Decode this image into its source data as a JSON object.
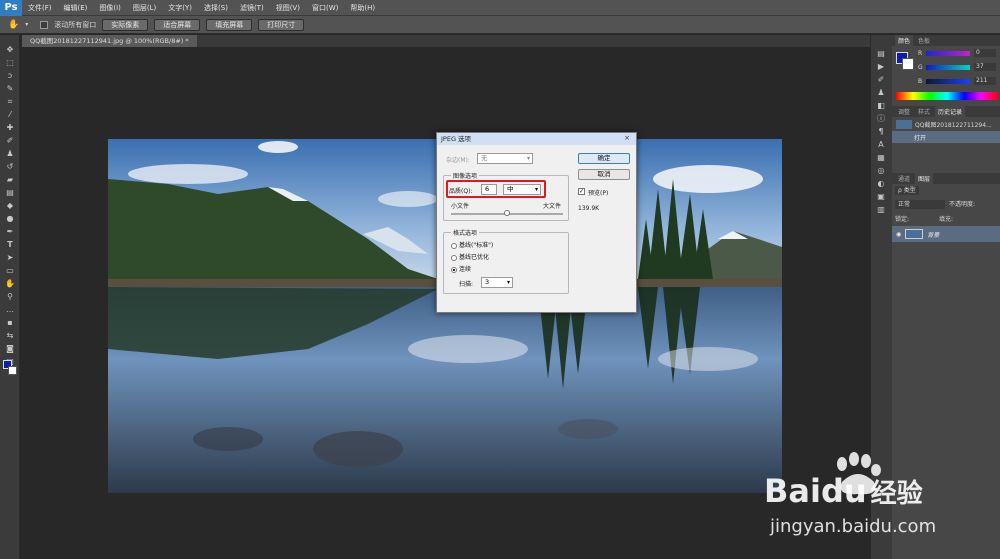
{
  "app": {
    "logo": "Ps"
  },
  "menu": [
    "文件(F)",
    "编辑(E)",
    "图像(I)",
    "图层(L)",
    "文字(Y)",
    "选择(S)",
    "滤镜(T)",
    "视图(V)",
    "窗口(W)",
    "帮助(H)"
  ],
  "options_bar": {
    "scroll_all_label": "滚动所有窗口",
    "buttons": [
      "实际像素",
      "适合屏幕",
      "填充屏幕",
      "打印尺寸"
    ]
  },
  "document_tab": "QQ截图20181227112941.jpg @ 100%(RGB/8#) *",
  "panels": {
    "color_tabs": [
      "颜色",
      "色板"
    ],
    "rgb": {
      "R": "0",
      "G": "37",
      "B": "211"
    },
    "history_tabs": [
      "调整",
      "样式",
      "历史记录"
    ],
    "history_items": [
      "QQ截图2018122711294...",
      "打开"
    ],
    "layers_tabs": [
      "通道",
      "图层"
    ],
    "layer_filter": "ρ 类型",
    "blend_mode": "正常",
    "opacity_label": "不透明度:",
    "lock_label": "锁定:",
    "fill_label": "填充:",
    "layer_name": "背景"
  },
  "dialog": {
    "title": "JPEG 选项",
    "close": "×",
    "matte_label": "杂边(M):",
    "matte_value": "无",
    "image_options_label": "图像选项",
    "quality_label": "品质(Q):",
    "quality_value": "6",
    "quality_level": "中",
    "small_file": "小文件",
    "large_file": "大文件",
    "quality_slider_fraction": 0.5,
    "format_options_label": "格式选项",
    "format_options": [
      "基线(\"标准\")",
      "基线已优化",
      "连续"
    ],
    "selected_format": 2,
    "scans_label": "扫描:",
    "scans_value": "3",
    "ok_label": "确定",
    "cancel_label": "取消",
    "preview_label": "预览(P)",
    "preview_checked": true,
    "file_size": "139.9K"
  },
  "watermark": {
    "brand": "Bai",
    "brand2": "du",
    "cn": "经验",
    "url": "jingyan.baidu.com"
  },
  "colors": {
    "accent": "#2f7ec3",
    "highlight": "#e0191d",
    "foreground": "#0b1fa8"
  }
}
